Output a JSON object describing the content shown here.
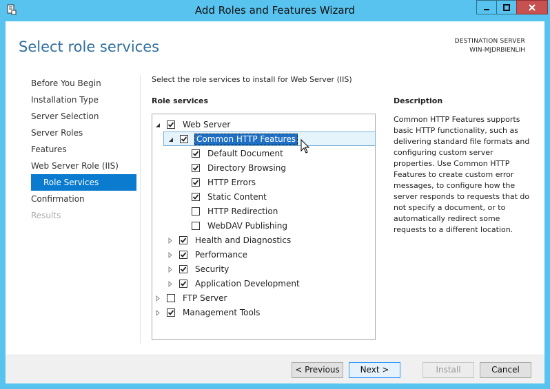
{
  "window": {
    "title": "Add Roles and Features Wizard"
  },
  "header": {
    "page_title": "Select role services",
    "destination_label": "DESTINATION SERVER",
    "destination_value": "WIN-MJDRBIENLIH"
  },
  "nav": {
    "items": [
      {
        "label": "Before You Begin",
        "state": "normal"
      },
      {
        "label": "Installation Type",
        "state": "normal"
      },
      {
        "label": "Server Selection",
        "state": "normal"
      },
      {
        "label": "Server Roles",
        "state": "normal"
      },
      {
        "label": "Features",
        "state": "normal"
      },
      {
        "label": "Web Server Role (IIS)",
        "state": "normal"
      },
      {
        "label": "Role Services",
        "state": "selected"
      },
      {
        "label": "Confirmation",
        "state": "normal"
      },
      {
        "label": "Results",
        "state": "disabled"
      }
    ]
  },
  "main": {
    "instruction": "Select the role services to install for Web Server (IIS)",
    "role_services_title": "Role services",
    "tree": [
      {
        "label": "Web Server",
        "level": 0,
        "expander": "expanded",
        "checked": true
      },
      {
        "label": "Common HTTP Features",
        "level": 1,
        "expander": "expanded",
        "checked": true,
        "selected": true
      },
      {
        "label": "Default Document",
        "level": 2,
        "expander": "none",
        "checked": true
      },
      {
        "label": "Directory Browsing",
        "level": 2,
        "expander": "none",
        "checked": true
      },
      {
        "label": "HTTP Errors",
        "level": 2,
        "expander": "none",
        "checked": true
      },
      {
        "label": "Static Content",
        "level": 2,
        "expander": "none",
        "checked": true
      },
      {
        "label": "HTTP Redirection",
        "level": 2,
        "expander": "none",
        "checked": false
      },
      {
        "label": "WebDAV Publishing",
        "level": 2,
        "expander": "none",
        "checked": false
      },
      {
        "label": "Health and Diagnostics",
        "level": 1,
        "expander": "collapsed",
        "checked": true
      },
      {
        "label": "Performance",
        "level": 1,
        "expander": "collapsed",
        "checked": true
      },
      {
        "label": "Security",
        "level": 1,
        "expander": "collapsed",
        "checked": true
      },
      {
        "label": "Application Development",
        "level": 1,
        "expander": "collapsed",
        "checked": true
      },
      {
        "label": "FTP Server",
        "level": 0,
        "expander": "collapsed",
        "checked": false
      },
      {
        "label": "Management Tools",
        "level": 0,
        "expander": "collapsed",
        "checked": true
      }
    ]
  },
  "description": {
    "title": "Description",
    "text": "Common HTTP Features supports basic HTTP functionality, such as delivering standard file formats and configuring custom server properties. Use Common HTTP Features to create custom error messages, to configure how the server responds to requests that do not specify a document, or to automatically redirect some requests to a different location."
  },
  "footer": {
    "previous_label": "< Previous",
    "next_label": "Next >",
    "install_label": "Install",
    "cancel_label": "Cancel"
  },
  "colors": {
    "title_bar": "#58c3ee",
    "accent": "#0a7bcf",
    "page_title": "#2e6e9e",
    "close_button": "#c75050"
  },
  "icons": {
    "app": "server-manager-icon",
    "minimize": "minimize-icon",
    "maximize": "maximize-icon",
    "close": "close-icon",
    "expanded": "triangle-expanded-icon",
    "collapsed": "triangle-collapsed-icon",
    "checkbox": "checkbox-icon",
    "cursor": "mouse-pointer-icon"
  }
}
